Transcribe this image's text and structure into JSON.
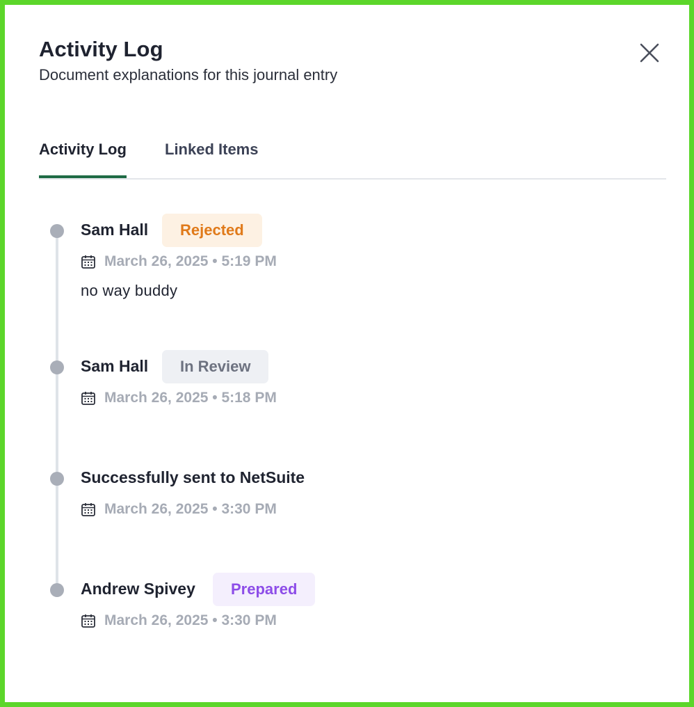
{
  "header": {
    "title": "Activity Log",
    "subtitle": "Document explanations for this journal entry"
  },
  "tabs": [
    {
      "label": "Activity Log",
      "active": true
    },
    {
      "label": "Linked Items",
      "active": false
    }
  ],
  "colors": {
    "frame": "#5cd62a",
    "tab_underline": "#1f6b45",
    "rejected": "#e07a1a",
    "in_review": "#6d7280",
    "prepared": "#8d4de8"
  },
  "activities": [
    {
      "name": "Sam Hall",
      "status": "Rejected",
      "date": "March 26, 2025 • 5:19 PM",
      "comment": "no way buddy"
    },
    {
      "name": "Sam Hall",
      "status": "In Review",
      "date": "March 26, 2025 • 5:18 PM"
    },
    {
      "name": "Successfully sent to NetSuite",
      "date": "March 26, 2025 • 3:30 PM"
    },
    {
      "name": "Andrew Spivey",
      "status": "Prepared",
      "date": "March 26, 2025 • 3:30 PM"
    }
  ],
  "icons": {
    "close": "close-icon",
    "calendar": "calendar-icon"
  }
}
